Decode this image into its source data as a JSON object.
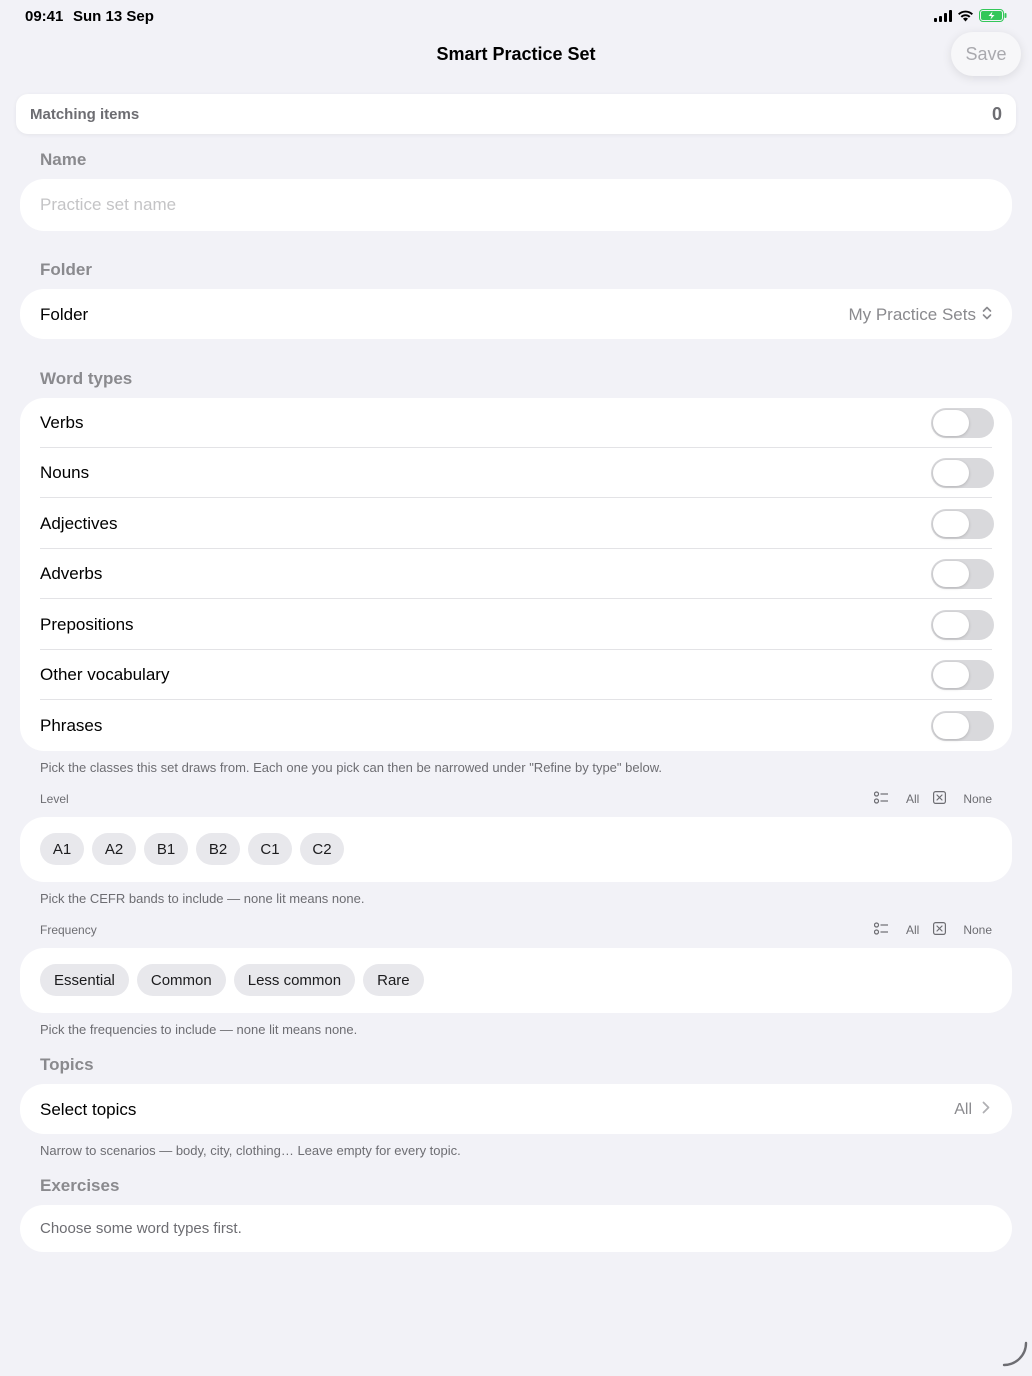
{
  "status": {
    "time": "09:41",
    "date": "Sun 13 Sep"
  },
  "nav": {
    "title": "Smart Practice Set",
    "save_label": "Save"
  },
  "matching": {
    "label": "Matching items",
    "count": "0"
  },
  "name_section": {
    "header": "Name",
    "placeholder": "Practice set name",
    "value": ""
  },
  "folder_section": {
    "header": "Folder",
    "row_label": "Folder",
    "value": "My Practice Sets"
  },
  "word_types": {
    "header": "Word types",
    "items": [
      {
        "label": "Verbs",
        "on": false
      },
      {
        "label": "Nouns",
        "on": false
      },
      {
        "label": "Adjectives",
        "on": false
      },
      {
        "label": "Adverbs",
        "on": false
      },
      {
        "label": "Prepositions",
        "on": false
      },
      {
        "label": "Other vocabulary",
        "on": false
      },
      {
        "label": "Phrases",
        "on": false
      }
    ],
    "footnote": "Pick the classes this set draws from. Each one you pick can then be narrowed under \"Refine by type\" below."
  },
  "level": {
    "header": "Level",
    "all_label": "All",
    "none_label": "None",
    "chips": [
      "A1",
      "A2",
      "B1",
      "B2",
      "C1",
      "C2"
    ],
    "footnote": "Pick the CEFR bands to include — none lit means none."
  },
  "frequency": {
    "header": "Frequency",
    "all_label": "All",
    "none_label": "None",
    "chips": [
      "Essential",
      "Common",
      "Less common",
      "Rare"
    ],
    "footnote": "Pick the frequencies to include — none lit means none."
  },
  "topics": {
    "header": "Topics",
    "row_label": "Select topics",
    "value": "All",
    "footnote": "Narrow to scenarios — body, city, clothing… Leave empty for every topic."
  },
  "exercises": {
    "header": "Exercises",
    "message": "Choose some word types first."
  },
  "colors": {
    "background": "#f2f2f7",
    "card": "#ffffff",
    "secondary_text": "#8a8a8e",
    "toggle_off": "#d9d9dc",
    "chip": "#e8e8ec",
    "battery": "#34c759"
  }
}
